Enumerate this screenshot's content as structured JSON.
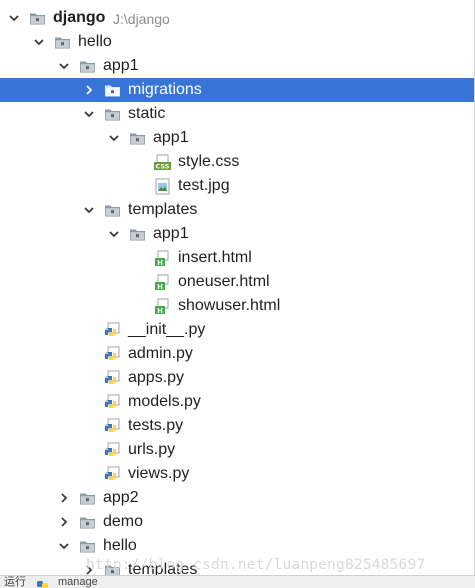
{
  "tree": [
    {
      "name": "django-root",
      "label": "django",
      "path": "J:\\django",
      "depth": 0,
      "kind": "folder",
      "state": "expanded",
      "bold": true
    },
    {
      "name": "hello",
      "label": "hello",
      "depth": 1,
      "kind": "folder",
      "state": "expanded"
    },
    {
      "name": "app1",
      "label": "app1",
      "depth": 2,
      "kind": "folder",
      "state": "expanded"
    },
    {
      "name": "migrations",
      "label": "migrations",
      "depth": 3,
      "kind": "folder",
      "state": "collapsed",
      "selected": true
    },
    {
      "name": "static",
      "label": "static",
      "depth": 3,
      "kind": "folder",
      "state": "expanded"
    },
    {
      "name": "static-app1",
      "label": "app1",
      "depth": 4,
      "kind": "folder",
      "state": "expanded"
    },
    {
      "name": "style-css",
      "label": "style.css",
      "depth": 5,
      "kind": "css"
    },
    {
      "name": "test-jpg",
      "label": "test.jpg",
      "depth": 5,
      "kind": "image"
    },
    {
      "name": "templates",
      "label": "templates",
      "depth": 3,
      "kind": "folder",
      "state": "expanded"
    },
    {
      "name": "templates-app1",
      "label": "app1",
      "depth": 4,
      "kind": "folder",
      "state": "expanded"
    },
    {
      "name": "insert-html",
      "label": "insert.html",
      "depth": 5,
      "kind": "html"
    },
    {
      "name": "oneuser-html",
      "label": "oneuser.html",
      "depth": 5,
      "kind": "html"
    },
    {
      "name": "showuser-html",
      "label": "showuser.html",
      "depth": 5,
      "kind": "html"
    },
    {
      "name": "init-py",
      "label": "__init__.py",
      "depth": 3,
      "kind": "python"
    },
    {
      "name": "admin-py",
      "label": "admin.py",
      "depth": 3,
      "kind": "python"
    },
    {
      "name": "apps-py",
      "label": "apps.py",
      "depth": 3,
      "kind": "python"
    },
    {
      "name": "models-py",
      "label": "models.py",
      "depth": 3,
      "kind": "python"
    },
    {
      "name": "tests-py",
      "label": "tests.py",
      "depth": 3,
      "kind": "python"
    },
    {
      "name": "urls-py",
      "label": "urls.py",
      "depth": 3,
      "kind": "python"
    },
    {
      "name": "views-py",
      "label": "views.py",
      "depth": 3,
      "kind": "python"
    },
    {
      "name": "app2",
      "label": "app2",
      "depth": 2,
      "kind": "folder",
      "state": "collapsed"
    },
    {
      "name": "demo",
      "label": "demo",
      "depth": 2,
      "kind": "folder",
      "state": "collapsed"
    },
    {
      "name": "hello-inner",
      "label": "hello",
      "depth": 2,
      "kind": "folder",
      "state": "expanded"
    },
    {
      "name": "templates-2",
      "label": "templates",
      "depth": 3,
      "kind": "folder",
      "state": "collapsed"
    }
  ],
  "bottom_bar": {
    "run_label": "运行",
    "file": "manage"
  },
  "watermark": "http://blog.csdn.net/luanpeng825485697",
  "colors": {
    "selection": "#3875d6",
    "folder": "#8f9aa5",
    "python_blue": "#3c78b5",
    "python_yellow": "#ffd43b",
    "html_green": "#4aa84a",
    "css_green": "#6a9a3a"
  }
}
